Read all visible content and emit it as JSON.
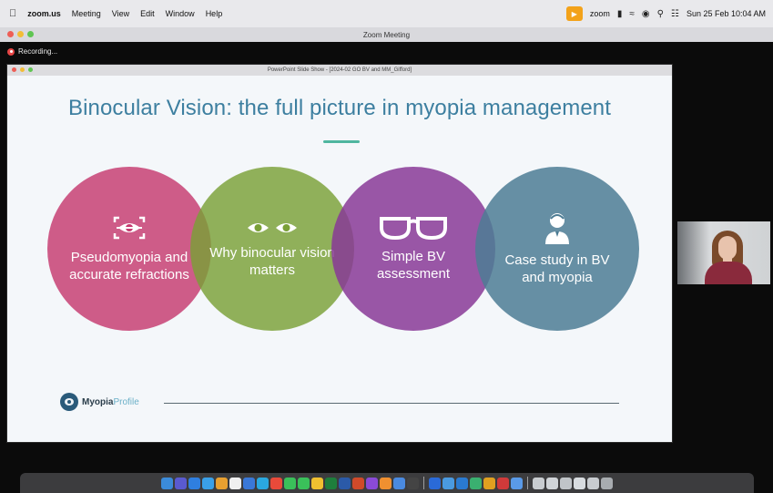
{
  "menubar": {
    "app_name": "zoom.us",
    "items": [
      "Meeting",
      "View",
      "Edit",
      "Window",
      "Help"
    ],
    "zoom_label": "zoom",
    "datetime": "Sun 25 Feb 10:04 AM"
  },
  "zoom_window": {
    "title": "Zoom Meeting",
    "recording_label": "Recording..."
  },
  "ppt_window": {
    "title": "PowerPoint Slide Show - [2024-02 GO BV and MM_Gifford]"
  },
  "slide": {
    "title": "Binocular Vision: the full picture in myopia management",
    "circles": [
      {
        "label": "Pseudomyopia and accurate refractions",
        "icon": "eye-scan-icon",
        "color": "#c6396f"
      },
      {
        "label": "Why binocular vision matters",
        "icon": "eyes-icon",
        "color": "#7aa037"
      },
      {
        "label": "Simple BV assessment",
        "icon": "glasses-icon",
        "color": "#883a96"
      },
      {
        "label": "Case study in BV and myopia",
        "icon": "person-icon",
        "color": "#4c7c94"
      }
    ],
    "logo": {
      "part1": "Myopia",
      "part2": "Profile"
    }
  },
  "colors": {
    "title_blue": "#3d7fa0",
    "accent_teal": "#4fb69f"
  }
}
